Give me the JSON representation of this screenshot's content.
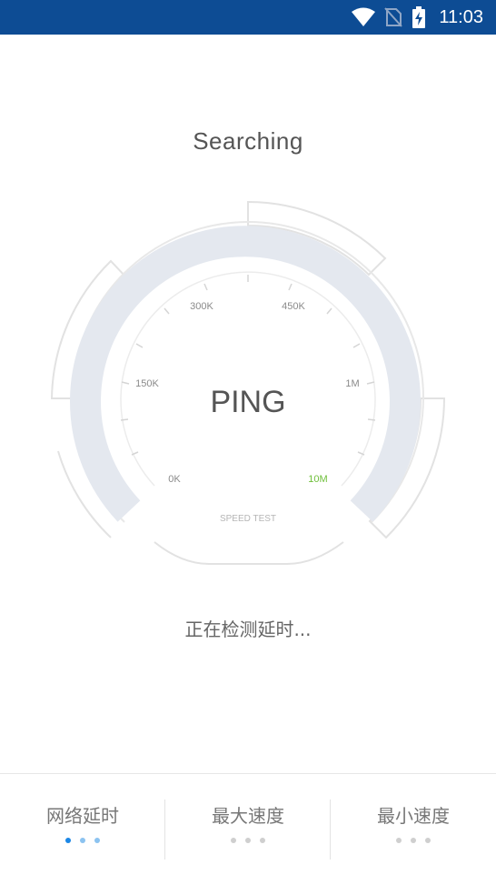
{
  "status_bar": {
    "time": "11:03",
    "icons": [
      "wifi-icon",
      "no-sim-icon",
      "battery-charging-icon"
    ],
    "color": "#0d4c94"
  },
  "title": "Searching",
  "gauge": {
    "center_label": "PING",
    "bottom_label": "SPEED TEST",
    "tick_labels": [
      "0K",
      "150K",
      "300K",
      "450K",
      "1M",
      "10M"
    ],
    "highlight_color": "#6fbf3b",
    "arc_color": "#e4e8ef"
  },
  "status_text": "正在检测延时...",
  "tabs": [
    {
      "label": "网络延时",
      "active": true
    },
    {
      "label": "最大速度",
      "active": false
    },
    {
      "label": "最小速度",
      "active": false
    }
  ]
}
